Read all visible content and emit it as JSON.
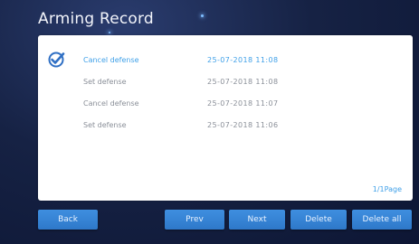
{
  "header": {
    "title": "Arming Record"
  },
  "records": [
    {
      "action": "Cancel defense",
      "time": "25-07-2018  11:08",
      "selected": true
    },
    {
      "action": "Set defense",
      "time": "25-07-2018  11:08",
      "selected": false
    },
    {
      "action": "Cancel defense",
      "time": "25-07-2018  11:07",
      "selected": false
    },
    {
      "action": "Set defense",
      "time": "25-07-2018  11:06",
      "selected": false
    }
  ],
  "pagination": {
    "label": "1/1Page"
  },
  "buttons": {
    "back": "Back",
    "prev": "Prev",
    "next": "Next",
    "delete": "Delete",
    "delete_all": "Delete all"
  },
  "colors": {
    "accent": "#3fa0e8",
    "button": "#3a86d8",
    "background": "#162244",
    "muted_text": "#8a8f98"
  }
}
